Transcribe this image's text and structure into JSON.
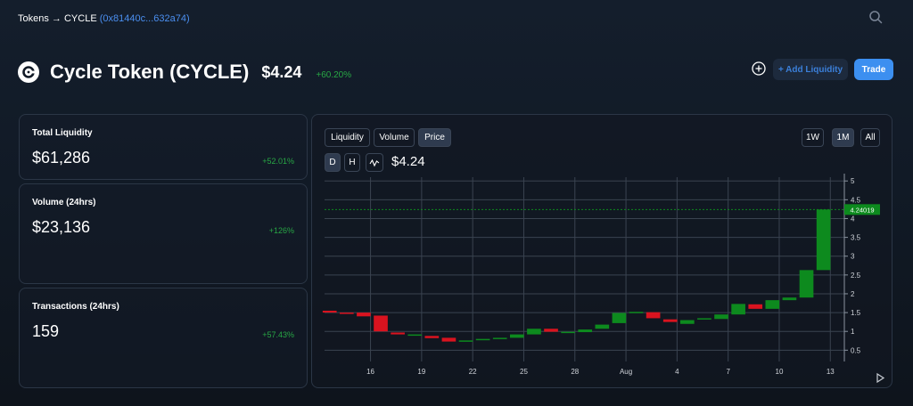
{
  "breadcrumb": {
    "root": "Tokens",
    "arrow": "→",
    "symbol": "CYCLE",
    "address": "(0x81440c...632a74)"
  },
  "token": {
    "name": "Cycle Token (CYCLE)",
    "price": "$4.24",
    "change": "+60.20%"
  },
  "actions": {
    "add_liquidity": "+ Add Liquidity",
    "trade": "Trade"
  },
  "stats": [
    {
      "label": "Total Liquidity",
      "value": "$61,286",
      "change": "+52.01%"
    },
    {
      "label": "Volume (24hrs)",
      "value": "$23,136",
      "change": "+126%"
    },
    {
      "label": "Transactions (24hrs)",
      "value": "159",
      "change": "+57.43%"
    }
  ],
  "chart_tabs": {
    "liquidity": "Liquidity",
    "volume": "Volume",
    "price": "Price",
    "selected": "Price"
  },
  "ranges": {
    "w1": "1W",
    "m1": "1M",
    "all": "All",
    "selected": "1M"
  },
  "interval": {
    "day": "D",
    "hour": "H",
    "selected": "D"
  },
  "chart_price": "$4.24",
  "colors": {
    "up": "#0d8a1e",
    "down": "#d9131f",
    "accent": "#3c8ff0",
    "positive": "#28a745"
  },
  "chart_data": {
    "type": "candlestick",
    "y_ticks": [
      "0.5",
      "1",
      "1.5",
      "2",
      "2.5",
      "3",
      "3.5",
      "4",
      "4.5",
      "5"
    ],
    "ylim": [
      0.2,
      5.1
    ],
    "x_ticks": [
      "16",
      "19",
      "22",
      "25",
      "28",
      "Aug",
      "4",
      "7",
      "10",
      "13"
    ],
    "last_price_label": "4.24019",
    "last_price": 4.24019,
    "candles": [
      {
        "o": 1.55,
        "c": 1.5
      },
      {
        "o": 1.5,
        "c": 1.48
      },
      {
        "o": 1.5,
        "c": 1.4
      },
      {
        "o": 1.42,
        "c": 1.0
      },
      {
        "o": 0.97,
        "c": 0.92
      },
      {
        "o": 0.9,
        "c": 0.92
      },
      {
        "o": 0.88,
        "c": 0.82
      },
      {
        "o": 0.83,
        "c": 0.73
      },
      {
        "o": 0.74,
        "c": 0.76
      },
      {
        "o": 0.77,
        "c": 0.8
      },
      {
        "o": 0.8,
        "c": 0.83
      },
      {
        "o": 0.83,
        "c": 0.92
      },
      {
        "o": 0.92,
        "c": 1.07
      },
      {
        "o": 1.07,
        "c": 0.99
      },
      {
        "o": 0.98,
        "c": 0.99
      },
      {
        "o": 0.98,
        "c": 1.05
      },
      {
        "o": 1.07,
        "c": 1.18
      },
      {
        "o": 1.22,
        "c": 1.49
      },
      {
        "o": 1.5,
        "c": 1.52
      },
      {
        "o": 1.51,
        "c": 1.35
      },
      {
        "o": 1.32,
        "c": 1.25
      },
      {
        "o": 1.2,
        "c": 1.3
      },
      {
        "o": 1.33,
        "c": 1.35
      },
      {
        "o": 1.33,
        "c": 1.45
      },
      {
        "o": 1.45,
        "c": 1.73
      },
      {
        "o": 1.72,
        "c": 1.6
      },
      {
        "o": 1.6,
        "c": 1.83
      },
      {
        "o": 1.83,
        "c": 1.9
      },
      {
        "o": 1.9,
        "c": 2.63
      },
      {
        "o": 2.63,
        "c": 4.24
      }
    ]
  }
}
